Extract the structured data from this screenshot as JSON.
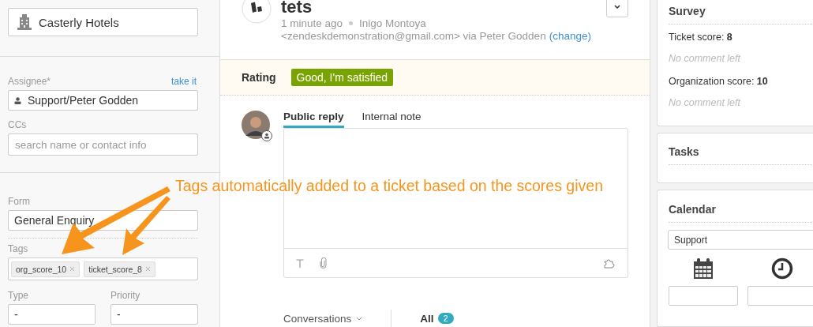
{
  "sidebar": {
    "brand": {
      "value": "Casterly Hotels"
    },
    "assignee": {
      "label": "Assignee*",
      "action": "take it",
      "value": "Support/Peter Godden"
    },
    "ccs": {
      "label": "CCs",
      "placeholder": "search name or contact info"
    },
    "form": {
      "label": "Form",
      "value": "General Enquiry"
    },
    "tags": {
      "label": "Tags",
      "items": [
        "org_score_10",
        "ticket_score_8"
      ]
    },
    "type": {
      "label": "Type",
      "value": "-"
    },
    "priority": {
      "label": "Priority",
      "value": "-"
    }
  },
  "ticket": {
    "title": "tets",
    "time": "1 minute ago",
    "requester": "Inigo Montoya",
    "email": "<zendeskdemonstration@gmail.com> via Peter Godden",
    "change_link": "(change)"
  },
  "rating": {
    "label": "Rating",
    "value": "Good, I'm satisfied"
  },
  "reply_tabs": [
    {
      "label": "Public reply",
      "selected": true
    },
    {
      "label": "Internal note",
      "selected": false
    }
  ],
  "conversations": {
    "label": "Conversations",
    "filter": "All",
    "count": "2"
  },
  "survey": {
    "title": "Survey",
    "scores": [
      {
        "label": "Ticket score:",
        "value": "8",
        "comment": "No comment left"
      },
      {
        "label": "Organization score:",
        "value": "10",
        "comment": "No comment left"
      }
    ]
  },
  "tasks": {
    "title": "Tasks"
  },
  "calendar": {
    "title": "Calendar",
    "value": "Support"
  },
  "annotation": {
    "text": "Tags automatically added to a ticket based on the scores given"
  }
}
